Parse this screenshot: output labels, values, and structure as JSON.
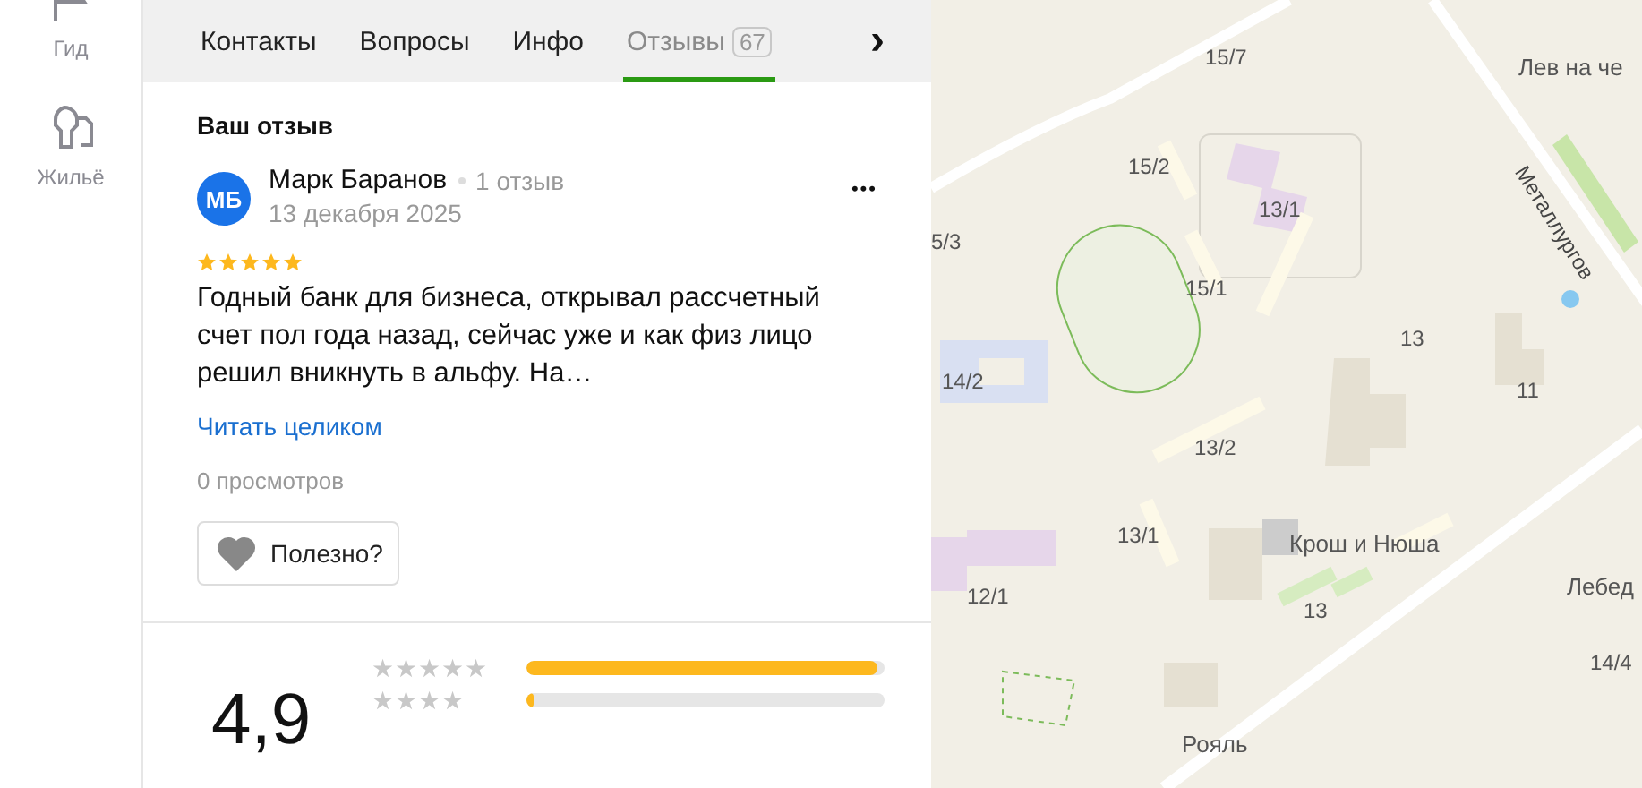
{
  "rail": [
    {
      "label": "Гид"
    },
    {
      "label": "Жильё"
    }
  ],
  "tabs": [
    {
      "label": "Контакты",
      "selected": false
    },
    {
      "label": "Вопросы",
      "selected": false
    },
    {
      "label": "Инфо",
      "selected": false
    },
    {
      "label": "Отзывы",
      "count": "67",
      "selected": true
    }
  ],
  "tabs_next": "›",
  "my_review": {
    "heading": "Ваш отзыв",
    "author": {
      "initials": "МБ",
      "name": "Марк Баранов",
      "reviews": "1 отзыв",
      "date": "13 декабря 2025"
    },
    "more": "•••",
    "stars": 5,
    "text": "Годный банк для бизнеса, открывал рассчетный счет пол года назад, сейчас уже и как физ лицо решил вникнуть в альфу. На…",
    "read_more": "Читать целиком",
    "views": "0 просмотров",
    "helpful": "Полезно?"
  },
  "summary": {
    "score": "4,9",
    "rows": [
      {
        "label": "★★★★★",
        "level": 0.98
      },
      {
        "label": "★★★★",
        "level": 0.02
      }
    ]
  },
  "map": {
    "labels": [
      {
        "text": "15/7",
        "kind": "house"
      },
      {
        "text": "Лев на че",
        "kind": "poi"
      },
      {
        "text": "15/2",
        "kind": "house"
      },
      {
        "text": "13/1",
        "kind": "house"
      },
      {
        "text": "5/3",
        "kind": "house"
      },
      {
        "text": "Металлургов",
        "kind": "street"
      },
      {
        "text": "15/1",
        "kind": "house"
      },
      {
        "text": "13",
        "kind": "house"
      },
      {
        "text": "14/2",
        "kind": "house"
      },
      {
        "text": "11",
        "kind": "house"
      },
      {
        "text": "13/2",
        "kind": "house"
      },
      {
        "text": "13/1",
        "kind": "house"
      },
      {
        "text": "Крош и Нюша",
        "kind": "poi"
      },
      {
        "text": "12/1",
        "kind": "house"
      },
      {
        "text": "13",
        "kind": "house"
      },
      {
        "text": "Лебед",
        "kind": "poi"
      },
      {
        "text": "14/4",
        "kind": "house"
      },
      {
        "text": "Рояль",
        "kind": "poi"
      }
    ]
  }
}
